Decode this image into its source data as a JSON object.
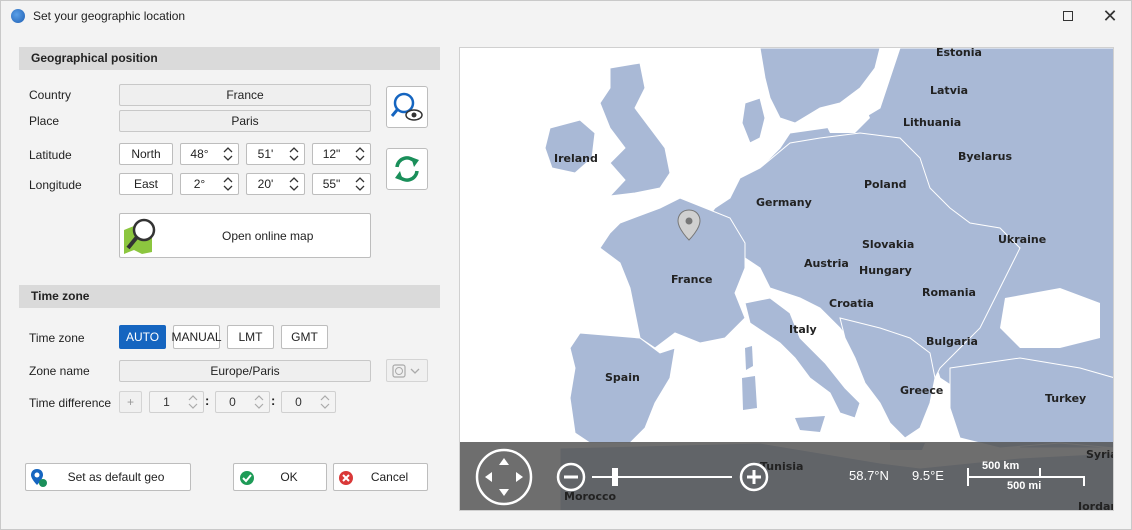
{
  "window": {
    "title": "Set your geographic location"
  },
  "geo": {
    "header": "Geographical position",
    "country_label": "Country",
    "country_value": "France",
    "place_label": "Place",
    "place_value": "Paris",
    "latitude_label": "Latitude",
    "latitude_hemisphere": "North",
    "latitude_deg": "48°",
    "latitude_min": "51'",
    "latitude_sec": "12\"",
    "longitude_label": "Longitude",
    "longitude_hemisphere": "East",
    "longitude_deg": "2°",
    "longitude_min": "20'",
    "longitude_sec": "55\"",
    "open_map_label": "Open online map"
  },
  "timezone": {
    "header": "Time zone",
    "tz_label": "Time zone",
    "modes": [
      "AUTO",
      "MANUAL",
      "LMT",
      "GMT"
    ],
    "active_mode": "AUTO",
    "zone_name_label": "Zone name",
    "zone_name_value": "Europe/Paris",
    "diff_label": "Time difference",
    "diff_sign": "+",
    "diff_hours": "1",
    "diff_minutes": "0",
    "diff_seconds": "0"
  },
  "footer": {
    "default_geo_label": "Set as default geo",
    "ok_label": "OK",
    "cancel_label": "Cancel"
  },
  "map": {
    "countries": [
      "Estonia",
      "Latvia",
      "Lithuania",
      "Byelarus",
      "Ireland",
      "Poland",
      "Germany",
      "Slovakia",
      "Ukraine",
      "Austria",
      "Hungary",
      "France",
      "Romania",
      "Croatia",
      "Italy",
      "Bulgaria",
      "Spain",
      "Greece",
      "Turkey",
      "Morocco",
      "Syria",
      "Jordan",
      "Tunisia"
    ],
    "coord_lat": "58.7°N",
    "coord_lon": "9.5°E",
    "scale_km": "500 km",
    "scale_mi": "500 mi",
    "zoom_level_fraction": 0.15
  },
  "colors": {
    "accent": "#1565c0",
    "land": "#a9b9d6",
    "sea": "#ffffff"
  }
}
